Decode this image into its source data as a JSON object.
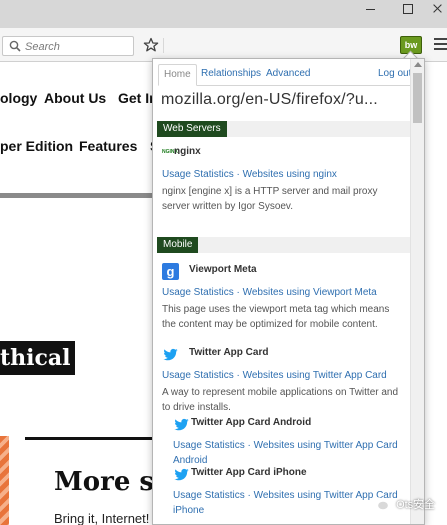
{
  "browser": {
    "search_placeholder": "Search",
    "extension_button_label": "bw",
    "icons": [
      "search-icon",
      "star-icon",
      "menu-icon",
      "minimize-icon",
      "maximize-icon",
      "close-icon"
    ]
  },
  "page": {
    "nav_row1": [
      "ology",
      "About Us",
      "Get In"
    ],
    "nav_row2": [
      "per Edition",
      "Features",
      "S"
    ],
    "highlight_text": "thical",
    "heading": "More sp",
    "body_text": "Bring it, Internet! We've spent the last year"
  },
  "popup": {
    "tabs": {
      "home": "Home",
      "relationships": "Relationships",
      "advanced": "Advanced",
      "logout": "Log out"
    },
    "url": "mozilla.org/en-US/firefox/?u...",
    "sections": [
      {
        "label": "Web Servers",
        "techs": [
          {
            "name": "nginx",
            "icon_label": "NGINX",
            "links": [
              "Usage Statistics",
              "Websites using nginx"
            ],
            "description": "nginx [engine x] is a HTTP server and mail proxy server written by Igor Sysoev."
          }
        ]
      },
      {
        "label": "Mobile",
        "techs": [
          {
            "name": "Viewport Meta",
            "icon_label": "g",
            "links": [
              "Usage Statistics",
              "Websites using Viewport Meta"
            ],
            "description": "This page uses the viewport meta tag which means the content may be optimized for mobile content."
          },
          {
            "name": "Twitter App Card",
            "links": [
              "Usage Statistics",
              "Websites using Twitter App Card"
            ],
            "description": "A way to represent mobile applications on Twitter and to drive installs."
          },
          {
            "name": "Twitter App Card Android",
            "links": [
              "Usage Statistics",
              "Websites using Twitter App Card Android"
            ]
          },
          {
            "name": "Twitter App Card iPhone",
            "links": [
              "Usage Statistics",
              "Websites using Twitter App Card iPhone"
            ]
          }
        ]
      }
    ]
  },
  "watermark": {
    "text": "Ots安全"
  }
}
